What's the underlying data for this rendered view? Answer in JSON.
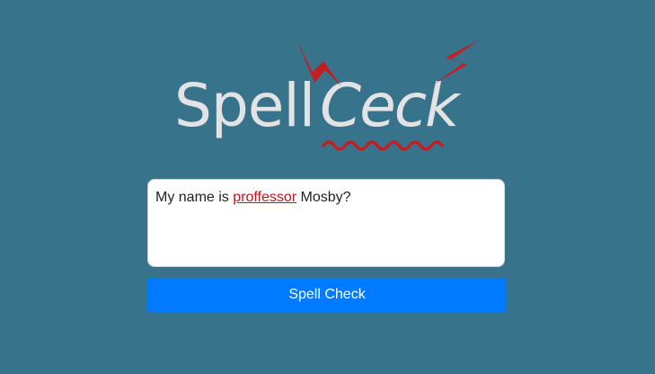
{
  "logo": {
    "word1": "Spell",
    "word2": "Ceck",
    "text_color": "#e3e3e6",
    "accent_color": "#c41e22"
  },
  "editor": {
    "text_before": "My name is ",
    "misspelled_word": "proffessor",
    "text_after": " Mosby?",
    "misspelled_color": "#c0141c"
  },
  "button": {
    "label": "Spell Check",
    "color": "#007bff"
  },
  "colors": {
    "background": "#37748c"
  }
}
